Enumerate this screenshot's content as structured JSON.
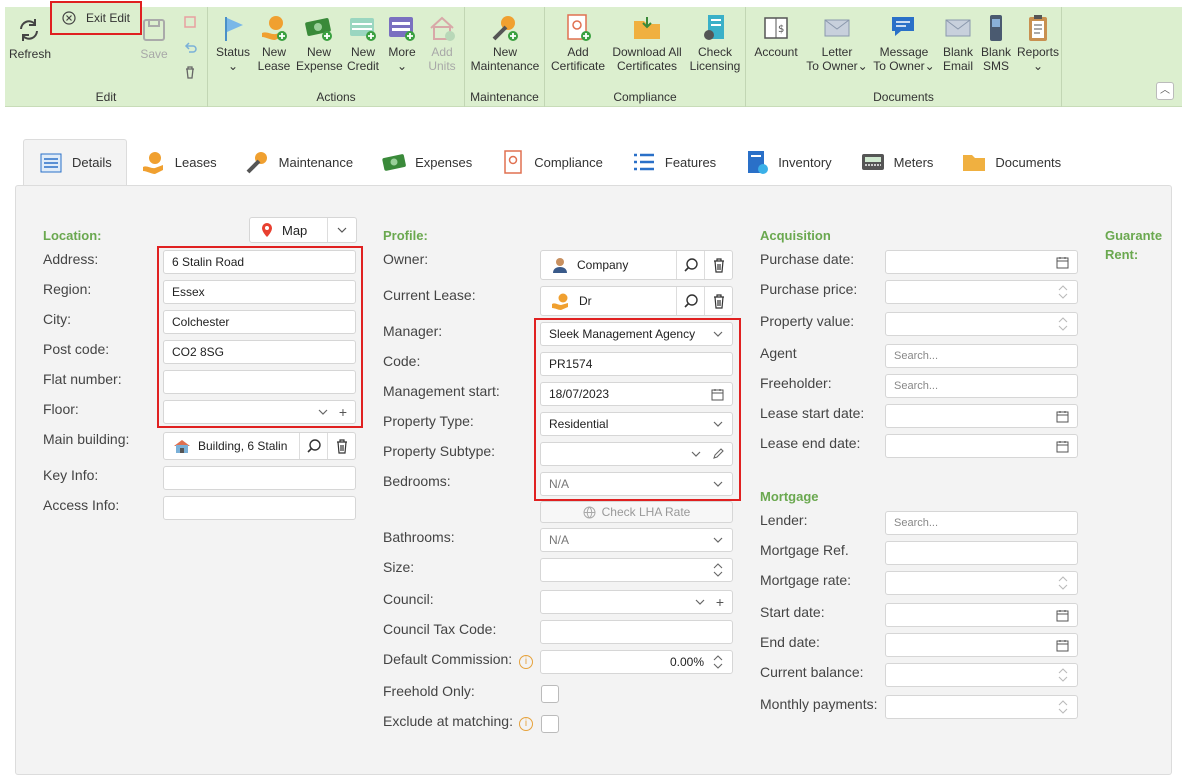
{
  "ribbon": {
    "exit_edit": "Exit Edit",
    "refresh": "Refresh",
    "save": "Save",
    "groups": {
      "edit": "Edit",
      "actions": "Actions",
      "maintenance": "Maintenance",
      "compliance": "Compliance",
      "documents": "Documents"
    },
    "actions": {
      "status": "Status",
      "new_lease_1": "New",
      "new_lease_2": "Lease",
      "new_expense_1": "New",
      "new_expense_2": "Expense",
      "new_credit_1": "New",
      "new_credit_2": "Credit",
      "more": "More",
      "add_units_1": "Add",
      "add_units_2": "Units"
    },
    "maintenance": {
      "new_1": "New",
      "new_2": "Maintenance"
    },
    "compliance": {
      "add_cert_1": "Add",
      "add_cert_2": "Certificate",
      "download_1": "Download All",
      "download_2": "Certificates",
      "check_1": "Check",
      "check_2": "Licensing"
    },
    "documents": {
      "account": "Account",
      "letter_1": "Letter",
      "letter_2": "To Owner",
      "message_1": "Message",
      "message_2": "To Owner",
      "blank_email_1": "Blank",
      "blank_email_2": "Email",
      "blank_sms_1": "Blank",
      "blank_sms_2": "SMS",
      "reports": "Reports"
    }
  },
  "tabs": {
    "details": "Details",
    "leases": "Leases",
    "maintenance": "Maintenance",
    "expenses": "Expenses",
    "compliance": "Compliance",
    "features": "Features",
    "inventory": "Inventory",
    "meters": "Meters",
    "documents": "Documents"
  },
  "location": {
    "section": "Location:",
    "map_button": "Map",
    "labels": {
      "address": "Address:",
      "region": "Region:",
      "city": "City:",
      "post_code": "Post code:",
      "flat_number": "Flat number:",
      "floor": "Floor:",
      "main_building": "Main building:",
      "key_info": "Key Info:",
      "access_info": "Access Info:"
    },
    "values": {
      "address": "6 Stalin Road",
      "region": "Essex",
      "city": "Colchester",
      "post_code": "CO2 8SG",
      "flat_number": "",
      "floor": "",
      "main_building": "Building, 6 Stalin",
      "key_info": "",
      "access_info": ""
    }
  },
  "profile": {
    "section": "Profile:",
    "labels": {
      "owner": "Owner:",
      "current_lease": "Current Lease:",
      "manager": "Manager:",
      "code": "Code:",
      "management_start": "Management start:",
      "property_type": "Property Type:",
      "property_subtype": "Property Subtype:",
      "bedrooms": "Bedrooms:",
      "bathrooms": "Bathrooms:",
      "size": "Size:",
      "council": "Council:",
      "council_tax_code": "Council Tax Code:",
      "default_commission": "Default Commission:",
      "freehold_only": "Freehold Only:",
      "exclude_matching": "Exclude at matching:"
    },
    "values": {
      "owner": "Company",
      "current_lease": "Dr",
      "manager": "Sleek Management Agency",
      "code": "PR1574",
      "management_start": "18/07/2023",
      "property_type": "Residential",
      "property_subtype": "",
      "bedrooms": "N/A",
      "check_lha": "Check LHA Rate",
      "bathrooms": "N/A",
      "size": "",
      "council": "",
      "council_tax_code": "",
      "default_commission": "0.00%"
    }
  },
  "acquisition": {
    "section": "Acquisition",
    "labels": {
      "purchase_date": "Purchase date:",
      "purchase_price": "Purchase price:",
      "property_value": "Property value:",
      "agent": "Agent",
      "freeholder": "Freeholder:",
      "lease_start": "Lease start date:",
      "lease_end": "Lease end date:"
    },
    "search_placeholder": "Search..."
  },
  "mortgage": {
    "section": "Mortgage",
    "labels": {
      "lender": "Lender:",
      "mortgage_ref": "Mortgage Ref.",
      "mortgage_rate": "Mortgage rate:",
      "start_date": "Start date:",
      "end_date": "End date:",
      "current_balance": "Current balance:",
      "monthly_payments": "Monthly payments:"
    },
    "search_placeholder": "Search..."
  },
  "guarantee": {
    "line1": "Guarante",
    "line2": "Rent:"
  },
  "colors": {
    "ribbon_bg": "#dcefcf",
    "section_green": "#6aa84f",
    "highlight_red": "#e02020"
  }
}
